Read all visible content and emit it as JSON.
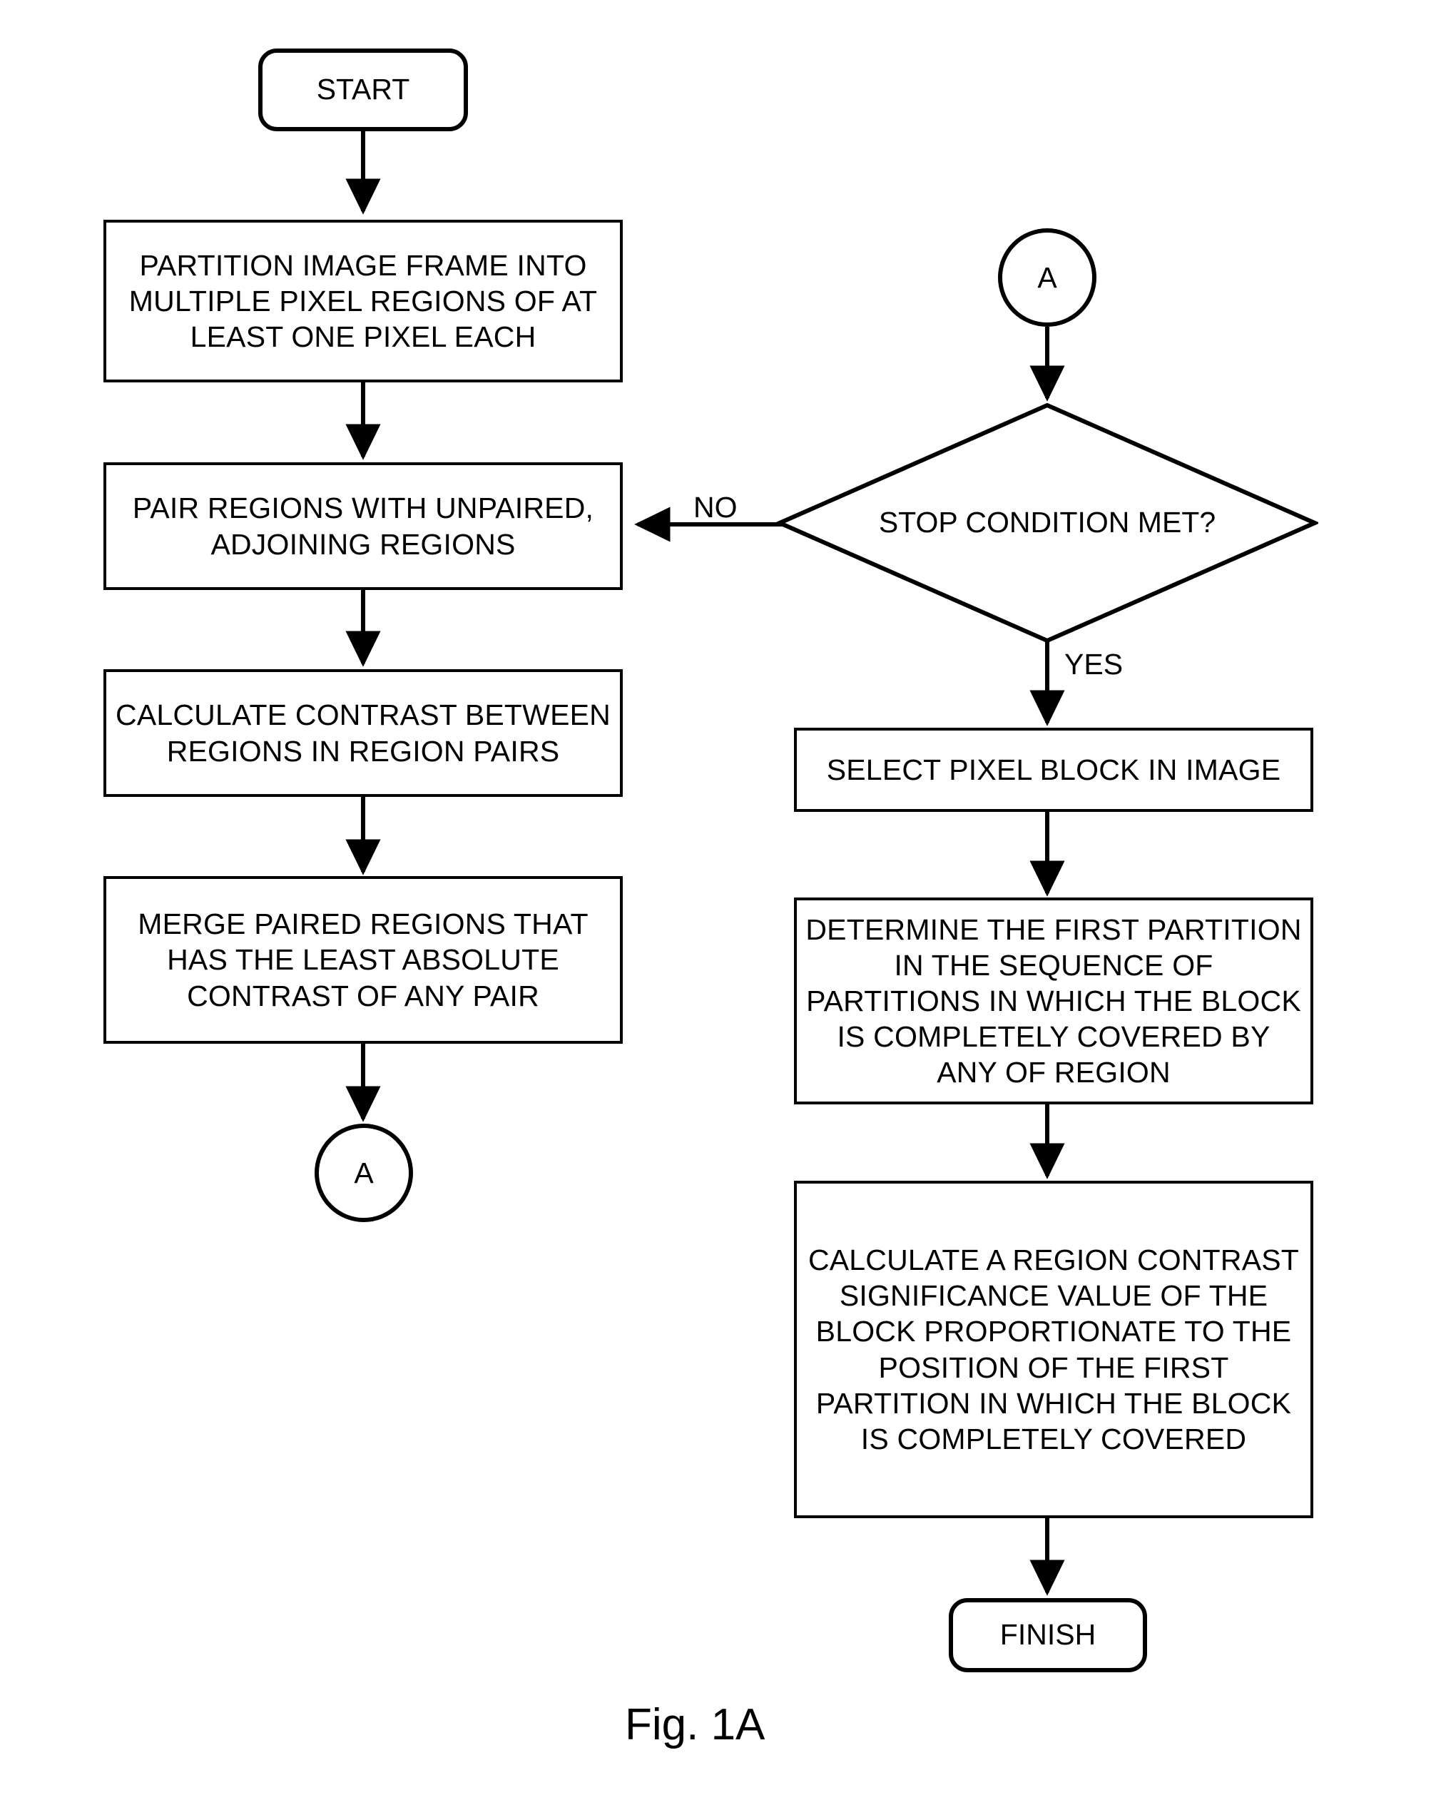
{
  "figure": {
    "caption": "Fig. 1A",
    "stroke_color": "#000000",
    "background_color": "#ffffff"
  },
  "nodes": {
    "start": {
      "label": "START",
      "shape": "terminator"
    },
    "partition": {
      "label": "PARTITION IMAGE FRAME INTO MULTIPLE PIXEL REGIONS OF AT LEAST ONE PIXEL EACH",
      "shape": "process"
    },
    "pair_regions": {
      "label": "PAIR REGIONS WITH UNPAIRED, ADJOINING REGIONS",
      "shape": "process"
    },
    "calculate_contrast": {
      "label": "CALCULATE CONTRAST BETWEEN REGIONS IN REGION PAIRS",
      "shape": "process"
    },
    "merge_regions": {
      "label": "MERGE PAIRED REGIONS THAT HAS THE LEAST ABSOLUTE CONTRAST OF ANY PAIR",
      "shape": "process"
    },
    "connector_a_out": {
      "label": "A",
      "shape": "connector"
    },
    "connector_a_in": {
      "label": "A",
      "shape": "connector"
    },
    "stop_condition": {
      "label": "STOP CONDITION MET?",
      "shape": "decision"
    },
    "select_block": {
      "label": "SELECT PIXEL BLOCK IN IMAGE",
      "shape": "process"
    },
    "determine_partition": {
      "label": "DETERMINE THE FIRST PARTITION IN THE SEQUENCE OF PARTITIONS IN WHICH THE BLOCK IS COMPLETELY COVERED BY ANY OF REGION",
      "shape": "process"
    },
    "calculate_significance": {
      "label": "CALCULATE A REGION CONTRAST SIGNIFICANCE VALUE OF THE BLOCK PROPORTIONATE TO THE POSITION OF THE FIRST PARTITION IN WHICH THE BLOCK IS COMPLETELY COVERED",
      "shape": "process"
    },
    "finish": {
      "label": "FINISH",
      "shape": "terminator"
    }
  },
  "edge_labels": {
    "no": "NO",
    "yes": "YES"
  }
}
